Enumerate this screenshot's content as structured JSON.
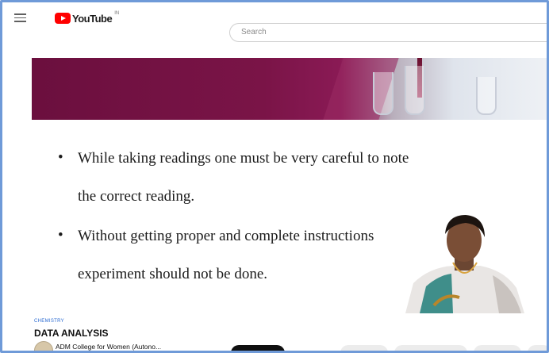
{
  "topbar": {
    "logo_text": "YouTube",
    "logo_country": "IN",
    "search_placeholder": "Search"
  },
  "slide": {
    "bullets": [
      {
        "line1": "While taking readings one must be very careful to note",
        "line2": "the correct reading."
      },
      {
        "line1": "Without getting proper and complete instructions",
        "line2": "experiment should not be done."
      }
    ]
  },
  "video_info": {
    "category": "CHEMISTRY",
    "title": "DATA ANALYSIS",
    "channel_name": "ADM College for Women (Autono..."
  },
  "colors": {
    "brand_red": "#ff0000",
    "banner_maroon": "#7a1447",
    "frame_border": "#6f9ad8"
  }
}
